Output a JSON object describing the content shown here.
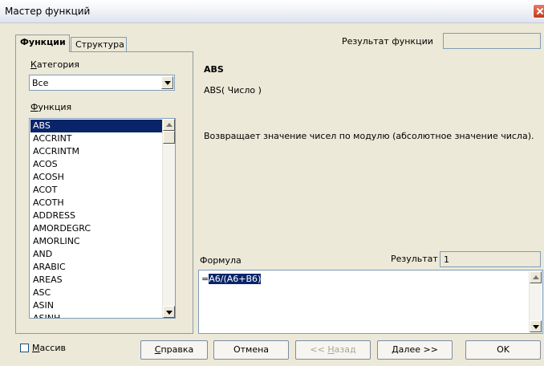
{
  "window": {
    "title": "Мастер функций"
  },
  "tabs": [
    {
      "label": "Функции",
      "active": true
    },
    {
      "label": "Структура",
      "active": false
    }
  ],
  "category": {
    "label": "Категория",
    "mnemonic": "К",
    "rest": "атегория",
    "value": "Все"
  },
  "function_list": {
    "label_mnemonic": "Ф",
    "label_rest": "ункция",
    "items": [
      "ABS",
      "ACCRINT",
      "ACCRINTM",
      "ACOS",
      "ACOSH",
      "ACOT",
      "ACOTH",
      "ADDRESS",
      "AMORDEGRC",
      "AMORLINC",
      "AND",
      "ARABIC",
      "AREAS",
      "ASC",
      "ASIN",
      "ASINH"
    ],
    "selected": "ABS"
  },
  "function_result": {
    "label": "Результат функции",
    "value": ""
  },
  "details": {
    "name": "ABS",
    "signature": "ABS( Число )",
    "description": "Возвращает значение чисел по модулю (абсолютное значение числа)."
  },
  "formula": {
    "label": "Формула",
    "prefix": "=",
    "selected_text": "A6/(A6+B6)"
  },
  "result": {
    "label": "Результат",
    "value": "1"
  },
  "array_checkbox": {
    "mnemonic": "М",
    "rest": "ассив",
    "checked": false
  },
  "buttons": {
    "help": {
      "mnemonic": "С",
      "rest": "правка"
    },
    "cancel": "Отмена",
    "back": {
      "prefix": "<< ",
      "mnemonic": "Н",
      "rest": "азад"
    },
    "next": {
      "mnemonic": "Д",
      "rest": "алее >>"
    },
    "ok": "OK"
  },
  "colors": {
    "selection": "#0a246a",
    "dialog_bg": "#ece9d8",
    "close_button": "#d4482b"
  }
}
